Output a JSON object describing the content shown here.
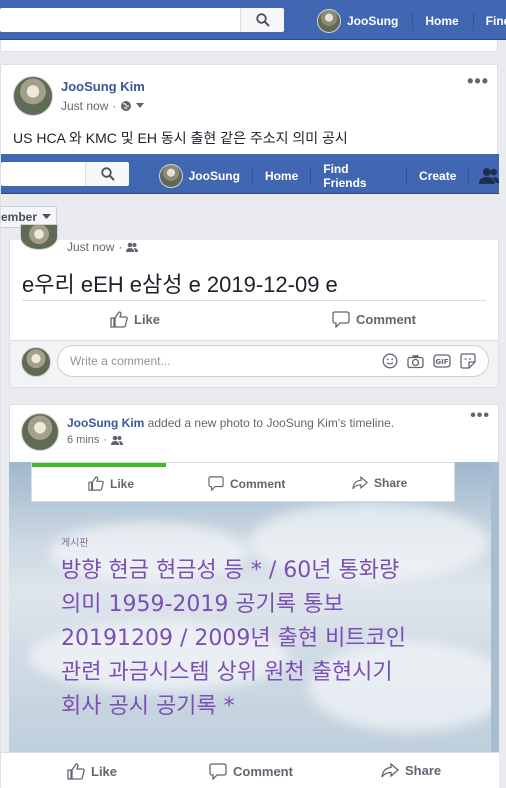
{
  "top_nav": {
    "user": "JooSung",
    "home": "Home",
    "find_friends_partial": "Find"
  },
  "post": {
    "author": "JooSung Kim",
    "timestamp": "Just now",
    "text": "US HCA 와 KMC 및 EH 동시 출현 같은 주소지 의미 공시"
  },
  "inner": {
    "nav": {
      "user": "JooSung",
      "home": "Home",
      "find_friends": "Find Friends",
      "create": "Create"
    },
    "member_dropdown": "ember",
    "status_post": {
      "timestamp": "Just now",
      "text": "e우리 eEH e삼성 e 2019-12-09 e",
      "like": "Like",
      "comment": "Comment",
      "comment_placeholder": "Write a comment..."
    }
  },
  "photo_post": {
    "author": "JooSung Kim",
    "action_text": " added a new photo to JooSung Kim's timeline.",
    "timestamp": "6 mins",
    "inner_like": "Like",
    "inner_comment": "Comment",
    "inner_share": "Share",
    "photo_label": "게시판",
    "photo_lines": [
      "방향 현금 현금성 등 * / 60년 통화량",
      "의미 1959-2019 공기록 통보",
      "20191209 / 2009년 출현 비트코인",
      "관련 과금시스템 상위 원천 출현시기",
      "회사 공시 공기록 *"
    ],
    "like": "Like",
    "comment": "Comment",
    "share": "Share"
  }
}
